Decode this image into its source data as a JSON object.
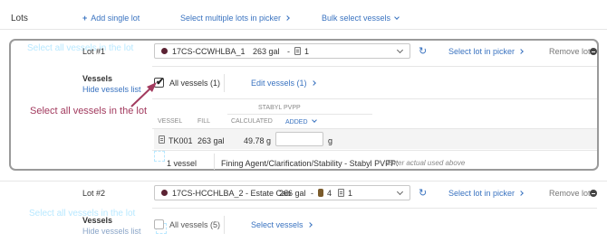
{
  "header": {
    "lots_label": "Lots",
    "add_single_lot": "Add single lot",
    "select_multiple": "Select multiple lots in picker",
    "bulk_select": "Bulk select vessels"
  },
  "lot1": {
    "label": "Lot #1",
    "lot_code": "17CS-CCWHLBA_1",
    "volume": "263 gal",
    "dash": "-",
    "vessel_count": "1",
    "select_in_picker": "Select lot in picker",
    "remove": "Remove lot",
    "vessels_label": "Vessels",
    "hide_vessels": "Hide vessels list",
    "all_vessels": "All vessels (1)",
    "edit_vessels": "Edit vessels (1)",
    "callout": "Select all vessels in the lot",
    "additive_header": "STABYL PVPP",
    "table_headers": {
      "vessel": "VESSEL",
      "fill": "FILL",
      "calculated": "CALCULATED",
      "added": "ADDED"
    },
    "row": {
      "vessel": "TK001",
      "fill": "263 gal",
      "calculated": "49.78 g",
      "added_value": "",
      "unit": "g"
    },
    "summary_count": "1 vessel",
    "summary_text": "Fining Agent/Clarification/Stability - Stabyl PVPP:",
    "summary_hint": "Enter actual used above"
  },
  "lot2": {
    "label": "Lot #2",
    "lot_code": "17CS-HCCHLBA_2 - Estate Cab",
    "volume": "266 gal",
    "dash": "-",
    "barrel_count": "4",
    "vessel_count": "1",
    "select_in_picker": "Select lot in picker",
    "remove": "Remove lot",
    "vessels_label": "Vessels",
    "hide_vessels": "Hide vessels list",
    "all_vessels": "All vessels (5)",
    "select_vessels": "Select vessels"
  },
  "colors": {
    "link": "#3a73c0",
    "callout": "#a23a5e",
    "frame": "#9a9a9a",
    "lot_dot": "#5b2233"
  }
}
